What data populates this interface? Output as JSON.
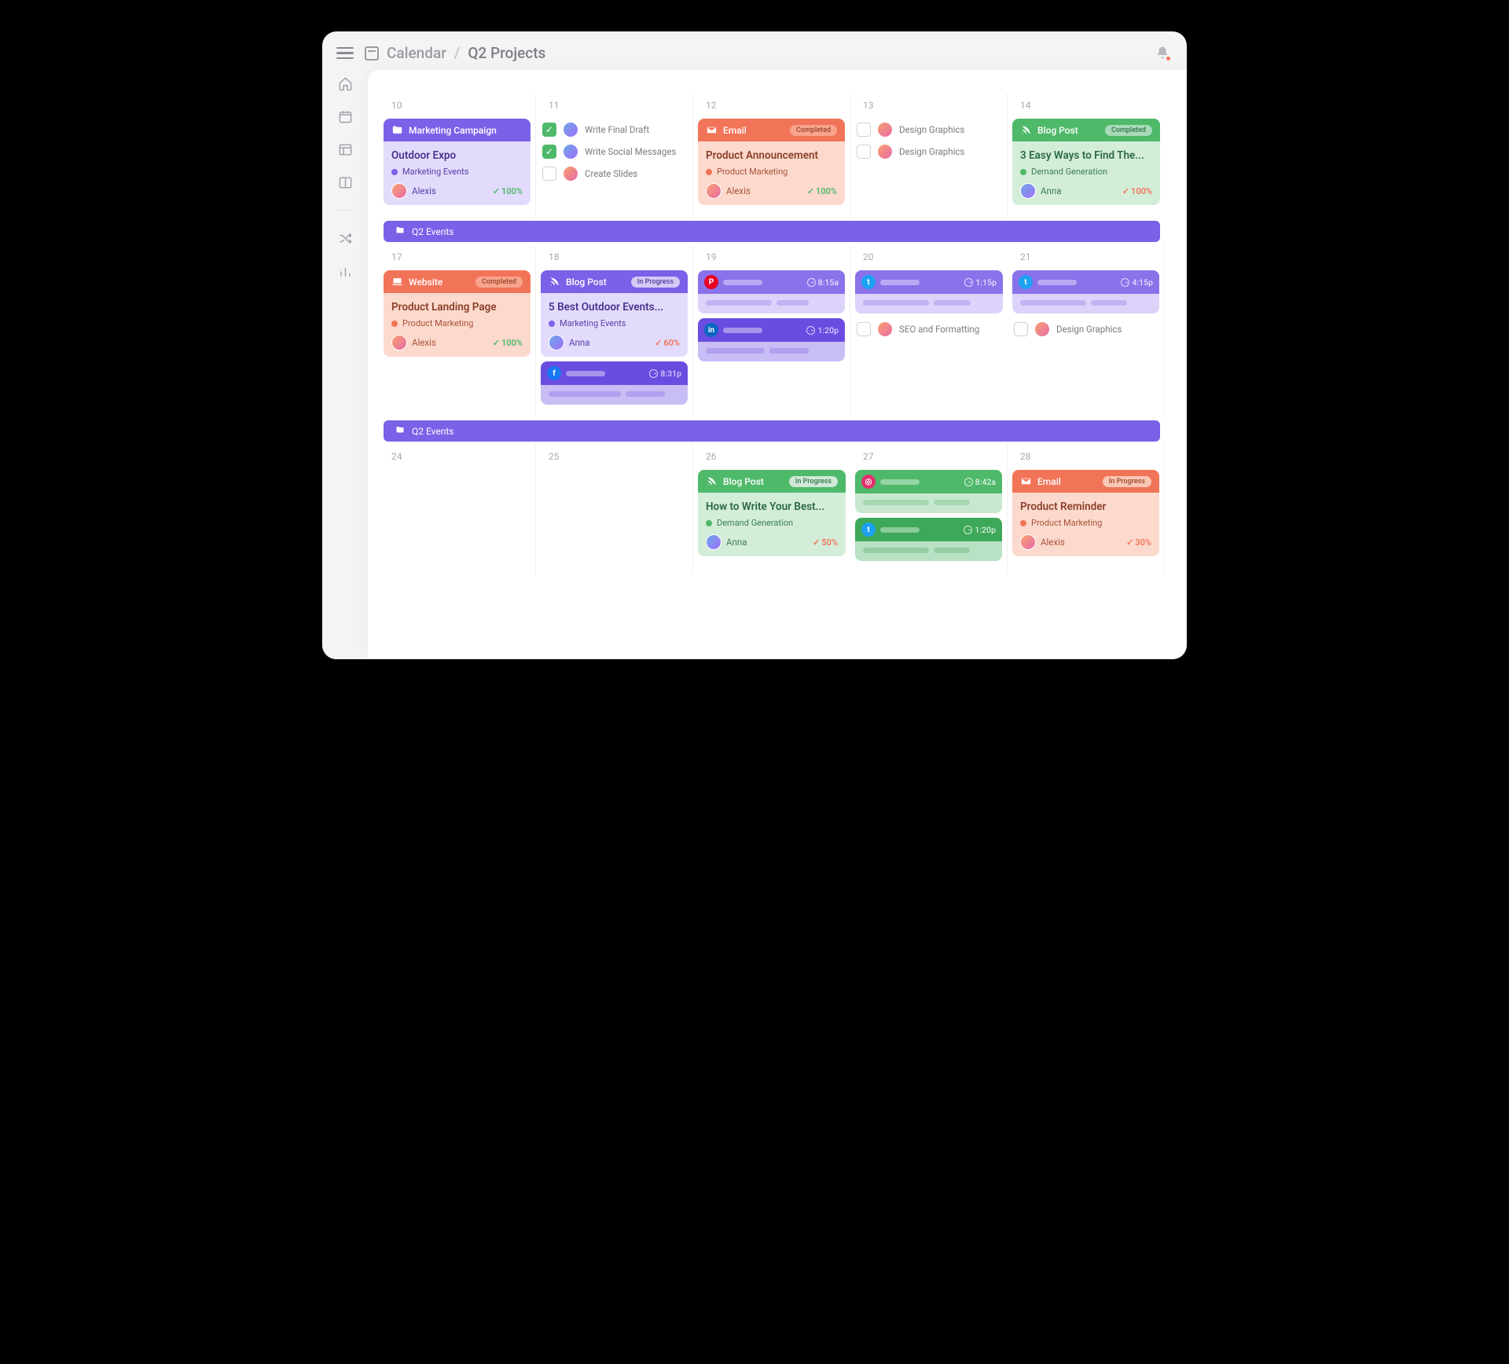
{
  "breadcrumb": {
    "root": "Calendar",
    "current": "Q2 Projects"
  },
  "spanBar": "Q2 Events",
  "days": {
    "r1": [
      "10",
      "11",
      "12",
      "13",
      "14"
    ],
    "r2": [
      "17",
      "18",
      "19",
      "20",
      "21"
    ],
    "r3": [
      "24",
      "25",
      "26",
      "27",
      "28"
    ]
  },
  "cards": {
    "marketing_campaign": {
      "header": "Marketing Campaign",
      "title": "Outdoor Expo",
      "tag": "Marketing Events",
      "assignee": "Alexis",
      "progress": "100%"
    },
    "email_announcement": {
      "header": "Email",
      "status": "Completed",
      "title": "Product Announcement",
      "tag": "Product Marketing",
      "assignee": "Alexis",
      "progress": "100%"
    },
    "blog_find": {
      "header": "Blog Post",
      "status": "Completed",
      "title": "3 Easy Ways to Find The...",
      "tag": "Demand Generation",
      "assignee": "Anna",
      "progress": "100%"
    },
    "website_landing": {
      "header": "Website",
      "status": "Completed",
      "title": "Product Landing Page",
      "tag": "Product Marketing",
      "assignee": "Alexis",
      "progress": "100%"
    },
    "blog_outdoor": {
      "header": "Blog Post",
      "status": "In Progress",
      "title": "5 Best Outdoor Events...",
      "tag": "Marketing Events",
      "assignee": "Anna",
      "progress": "60%"
    },
    "blog_write_best": {
      "header": "Blog Post",
      "status": "In Progress",
      "title": "How to Write Your Best...",
      "tag": "Demand Generation",
      "assignee": "Anna",
      "progress": "50%"
    },
    "email_reminder": {
      "header": "Email",
      "status": "In Progress",
      "title": "Product Reminder",
      "tag": "Product Marketing",
      "assignee": "Alexis",
      "progress": "30%"
    }
  },
  "tasks": {
    "d11": [
      {
        "label": "Write Final Draft",
        "done": true
      },
      {
        "label": "Write Social Messages",
        "done": true
      },
      {
        "label": "Create Slides",
        "done": false
      }
    ],
    "d13": [
      {
        "label": "Design Graphics",
        "done": false
      },
      {
        "label": "Design Graphics",
        "done": false
      }
    ],
    "d20": [
      {
        "label": "SEO and Formatting",
        "done": false
      }
    ],
    "d21": [
      {
        "label": "Design Graphics",
        "done": false
      }
    ]
  },
  "social": {
    "d18_fb": {
      "time": "8:31p"
    },
    "d19_pin": {
      "time": "8:15a"
    },
    "d19_li": {
      "time": "1:20p"
    },
    "d20_tw": {
      "time": "1:15p"
    },
    "d21_tw": {
      "time": "4:15p"
    },
    "d27_ig": {
      "time": "8:42a"
    },
    "d27_tw": {
      "time": "1:20p"
    }
  }
}
